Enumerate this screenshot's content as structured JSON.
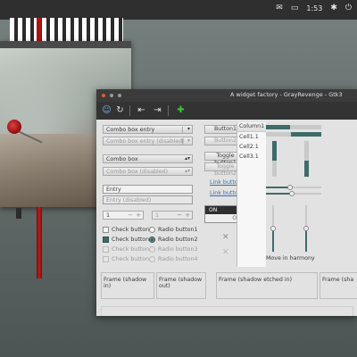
{
  "panel": {
    "mail_icon": "mail-icon",
    "battery_icon": "battery-icon",
    "clock": "1:53",
    "bluetooth_icon": "bluetooth-icon",
    "power_icon": "power-icon"
  },
  "window": {
    "title": "A widget factory - GrayRevenge - Gtk3"
  },
  "toolbar": {
    "icons": [
      "user-icon",
      "refresh-icon",
      "go-first-icon",
      "go-last-icon",
      "add-icon"
    ]
  },
  "combos": {
    "combo_entry": "Combo box entry",
    "combo_entry_disabled": "Combo box entry (disabled)",
    "combo_box": "Combo box",
    "combo_box_disabled": "Combo box (disabled)"
  },
  "entries": {
    "entry": "Entry",
    "entry_disabled": "Entry (disabled)"
  },
  "spins": {
    "spin1": "1",
    "spin2": "1"
  },
  "checks": [
    {
      "label": "Check button1",
      "state": "unchecked"
    },
    {
      "label": "Check button2",
      "state": "checked"
    },
    {
      "label": "Check button3",
      "state": "disabled"
    },
    {
      "label": "Check button4",
      "state": "disabled"
    }
  ],
  "radios": [
    {
      "label": "Radio button1",
      "state": "unchecked"
    },
    {
      "label": "Radio button2",
      "state": "checked"
    },
    {
      "label": "Radio button3",
      "state": "disabled"
    },
    {
      "label": "Radio button4",
      "state": "disabled"
    }
  ],
  "buttons": {
    "button1": "Button1",
    "button2": "Button2",
    "toggle1": "Toggle button1",
    "toggle2": "Toggle button2",
    "link1": "Link button1",
    "link2": "Link button2"
  },
  "switch": {
    "on": "ON",
    "off": "OFF"
  },
  "harmony": {
    "label": "Move in harmony",
    "checked": true
  },
  "tree": {
    "column": "Column1",
    "cells": [
      "Cell1.1",
      "Cell2.1",
      "Cell3.1"
    ]
  },
  "frames": {
    "in": "Frame (shadow in)",
    "out": "Frame (shadow out)",
    "etched_in": "Frame (shadow etched in)",
    "etched_out": "Frame (sha"
  },
  "colors": {
    "accent": "#3e6b6a",
    "link": "#3c6fa5",
    "red": "#b01313"
  }
}
